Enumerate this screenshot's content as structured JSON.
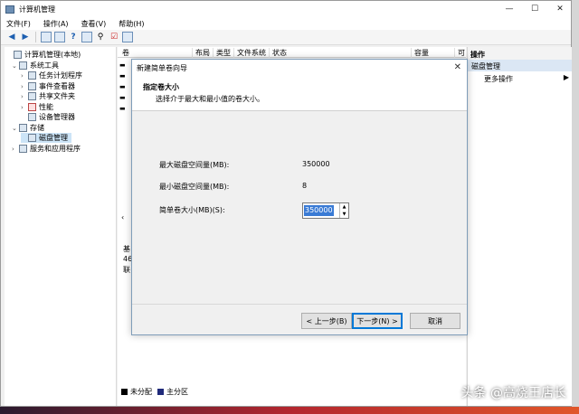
{
  "window": {
    "title": "计算机管理",
    "minimize": "—",
    "maximize": "☐",
    "close": "✕"
  },
  "menu": [
    "文件(F)",
    "操作(A)",
    "查看(V)",
    "帮助(H)"
  ],
  "tree": {
    "root": "计算机管理(本地)",
    "system_tools": "系统工具",
    "task_scheduler": "任务计划程序",
    "event_viewer": "事件查看器",
    "shared_folders": "共享文件夹",
    "performance": "性能",
    "device_manager": "设备管理器",
    "storage": "存储",
    "disk_management": "磁盘管理",
    "services_apps": "服务和应用程序"
  },
  "columns": [
    "卷",
    "布局",
    "类型",
    "文件系统",
    "状态",
    "容量",
    "可"
  ],
  "left_fragments": [
    "基",
    "46",
    "联"
  ],
  "legend": {
    "unallocated": "未分配",
    "primary": "主分区",
    "unallocated_color": "#000000",
    "primary_color": "#1f2a7a"
  },
  "actions": {
    "header": "操作",
    "section": "磁盘管理",
    "more": "更多操作"
  },
  "dialog": {
    "title": "新建简单卷向导",
    "heading": "指定卷大小",
    "subheading": "选择介于最大和最小值的卷大小。",
    "max_label": "最大磁盘空间量(MB):",
    "max_value": "350000",
    "min_label": "最小磁盘空间量(MB):",
    "min_value": "8",
    "size_label": "简单卷大小(MB)(S):",
    "size_value": "350000",
    "back": "< 上一步(B)",
    "next": "下一步(N) >",
    "cancel": "取消"
  },
  "watermark": "头条 @高烧王店长"
}
